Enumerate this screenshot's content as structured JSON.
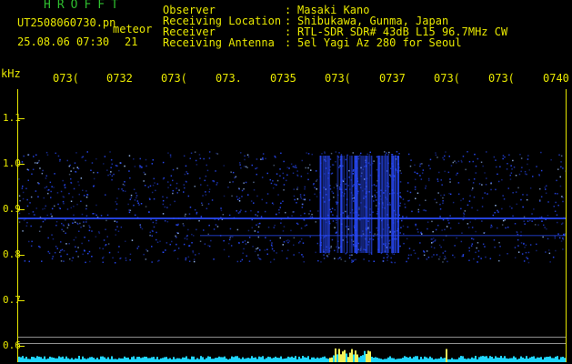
{
  "header": {
    "app_title": "HROFFT",
    "file_name": "UT2508060730.pn",
    "mode": "meteor",
    "timestamp": "25.08.06 07:30",
    "count": "21"
  },
  "info": [
    {
      "label": "Observer",
      "value": "Masaki Kano"
    },
    {
      "label": "Receiving Location",
      "value": "Shibukawa, Gunma, Japan"
    },
    {
      "label": "Receiver",
      "value": "RTL-SDR SDR# 43dB L15 96.7MHz CW"
    },
    {
      "label": "Receiving Antenna",
      "value": "5el Yagi Az 280 for Seoul"
    }
  ],
  "separator": ":",
  "chart_data": {
    "type": "heatmap",
    "ylabel": "kHz",
    "y_ticks": [
      "1.1",
      "1.0",
      "0.9",
      "0.8",
      "0.7",
      "0.6"
    ],
    "x_ticks": [
      "073(",
      "0732",
      "073(",
      "073.",
      "0735",
      "073(",
      "0737",
      "073(",
      "073(",
      "0740"
    ],
    "ylim": [
      0.6,
      1.15
    ],
    "colors": {
      "signal": "#2a4cff",
      "bright": "#9fc2ff",
      "background": "#000000",
      "axis": "#e8e800",
      "noise_bar": "#1fd6ff",
      "noise_peak": "#f2f25a"
    }
  }
}
